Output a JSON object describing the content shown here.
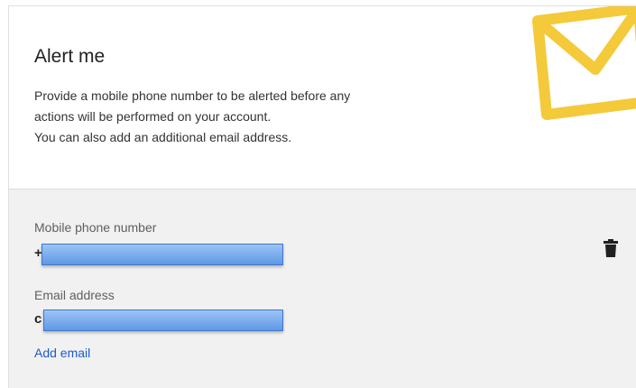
{
  "alert": {
    "title": "Alert me",
    "description_lines": [
      "Provide a mobile phone number to be alerted before any",
      "actions will be performed on your account.",
      "You can also add an additional email address."
    ]
  },
  "phone": {
    "label": "Mobile phone number",
    "value_visible_prefix": "+"
  },
  "email": {
    "label": "Email address",
    "value_visible_prefix": "c"
  },
  "links": {
    "add_email": "Add email"
  },
  "icons": {
    "envelope": "envelope-icon",
    "delete": "trash-icon"
  },
  "colors": {
    "envelope": "#f4c93a",
    "link": "#1a5bcc",
    "redaction": "#6fa3ea",
    "panel": "#f1f1f1"
  }
}
